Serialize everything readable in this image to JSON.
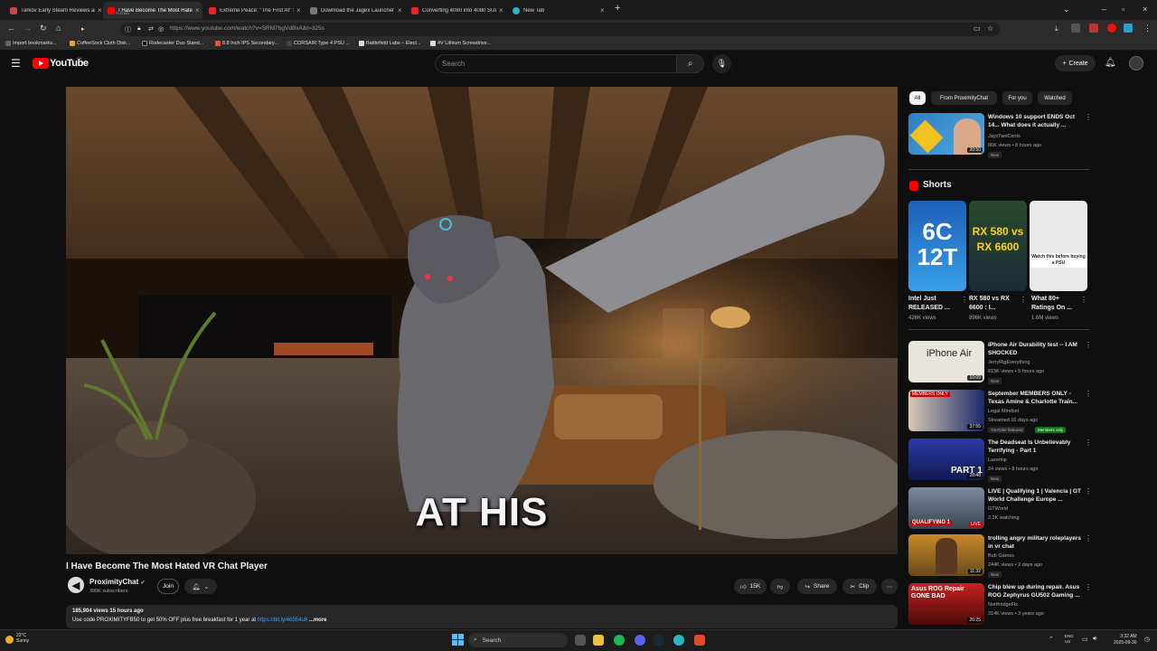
{
  "browser": {
    "tabs": [
      {
        "title": "Tarkov Early Steam Reviews and..."
      },
      {
        "title": "I Have Become The Most Hated",
        "sub": "PLAYING"
      },
      {
        "title": "Extreme Peace: \"The First AI\" St"
      },
      {
        "title": "Download the Jagex Launcher -"
      },
      {
        "title": "Converting 4080 into 4080 SUP"
      },
      {
        "title": "New Tab"
      }
    ],
    "url": "https://www.youtube.com/watch?v=SRM7bgVdBxA&t=325s",
    "bookmarks": [
      "Import bookmarks...",
      "CoffeeSock Cloth Disk...",
      "Rodecaster Duo Stand...",
      "8.8 Inch IPS Secondary...",
      "CORSAIR Type 4 PSU ...",
      "Battlefield Labs – Elect...",
      "4V Lithium Screwdrive..."
    ]
  },
  "header": {
    "logo_text": "YouTube",
    "region": "CA",
    "search_placeholder": "Search",
    "create_label": "Create"
  },
  "video": {
    "caption": "AT HIS",
    "title": "I Have Become The Most Hated VR Chat Player",
    "channel": "ProximityChat",
    "subscribers": "395K subscribers",
    "join_label": "Join",
    "likes": "15K",
    "share_label": "Share",
    "clip_label": "Clip",
    "views_line": "185,904 views  15 hours ago",
    "description_prefix": "Use code PROXIMITYFB50 to get 50% OFF plus free breakfast for 1 year at ",
    "description_link": "https://bit.ly/46554u9",
    "description_more": "...more"
  },
  "sidebar": {
    "chips": [
      "All",
      "From ProximityChat",
      "For you",
      "Watched"
    ],
    "first": {
      "title": "Windows 10 support ENDS Oct 14... What does it actually ...",
      "channel": "JayzTwoCents",
      "meta": "66K views • 8 hours ago",
      "badge": "New",
      "duration": "20:50"
    },
    "shorts_title": "Shorts",
    "shorts": [
      {
        "title": "Intel Just RELEASED ...",
        "views": "426K views",
        "art": "6C 12T"
      },
      {
        "title": "RX 580 vs RX 6600 : I...",
        "views": "896K views",
        "art": "RX 580 vs RX 6600"
      },
      {
        "title": "What 80+ Ratings On ...",
        "views": "1.6M views",
        "art": "Watch this before buying a PSU"
      }
    ],
    "videos": [
      {
        "title": "iPhone Air Durability test -- I AM SHOCKED",
        "channel": "JerryRigEverything",
        "meta": "815K views • 5 hours ago",
        "badge": "New",
        "duration": "10:09",
        "thumb_text": "iPhone Air"
      },
      {
        "title": "September MEMBERS ONLY - Texas Amine & Charlotte Train...",
        "channel": "Legal Mindset",
        "meta": "Streamed 10 days ago",
        "badge": "YouTube featured",
        "badge2": "Members only",
        "duration": "37:55",
        "thumb_text": "MEMBERS ONLY"
      },
      {
        "title": "The Deadseat Is Unbelievably Terrifying - Part 1",
        "channel": "Lazemip",
        "meta": "24 views • 8 hours ago",
        "badge": "New",
        "duration": "28:48",
        "thumb_text": "PART 1"
      },
      {
        "title": "LIVE | Qualifying 1 | Valencia | GT World Challenge Europe ...",
        "channel": "GTWorld",
        "meta": "2.2K watching",
        "badge": "",
        "duration": "LIVE",
        "thumb_text": "QUALIFYING 1"
      },
      {
        "title": "trolling angry military roleplayers in vr chat",
        "channel": "Bub Games",
        "meta": "244K views • 2 days ago",
        "badge": "New",
        "duration": "11:32",
        "thumb_text": ""
      },
      {
        "title": "Chip blew up during repair. Asus ROG Zephyrus GU502 Gaming ...",
        "channel": "NorthridgeFix",
        "meta": "314K views • 3 years ago",
        "badge": "",
        "duration": "26:25",
        "thumb_text": "Asus ROG Repair GONE BAD"
      }
    ]
  },
  "taskbar": {
    "weather_temp": "22°C",
    "weather_desc": "Sunny",
    "search_label": "Search",
    "lang1": "ENG",
    "lang2": "US",
    "time": "3:32 AM",
    "date": "2025-09-30"
  }
}
